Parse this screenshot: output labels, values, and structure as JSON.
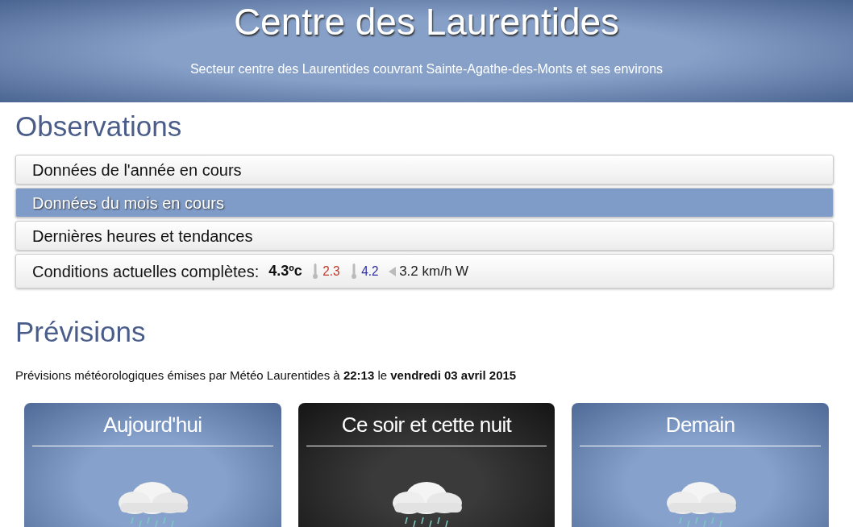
{
  "header": {
    "title": "Centre des Laurentides",
    "subtitle": "Secteur centre des Laurentides couvrant Sainte-Agathe-des-Monts et ses environs"
  },
  "observations": {
    "heading": "Observations",
    "items": [
      {
        "label": "Données de l'année en cours",
        "selected": false
      },
      {
        "label": "Données du mois en cours",
        "selected": true
      },
      {
        "label": "Dernières heures et tendances",
        "selected": false
      }
    ],
    "conditions": {
      "label": "Conditions actuelles complètes:",
      "temperature": "4.3ºc",
      "readings": [
        {
          "kind": "min",
          "value": "2.3",
          "color": "#c0392b"
        },
        {
          "kind": "max",
          "value": "4.2",
          "color": "#2e2ea8"
        },
        {
          "kind": "wind",
          "value": "3.2 km/h W"
        }
      ]
    }
  },
  "forecast": {
    "heading": "Prévisions",
    "intro": "Prévisions météorologiques émises par Météo Laurentides à **22:13** le **vendredi 03 avril 2015**",
    "cards": [
      {
        "title": "Aujourd'hui",
        "kind": "day"
      },
      {
        "title": "Ce soir et cette nuit",
        "kind": "night"
      },
      {
        "title": "Demain",
        "kind": "day"
      }
    ]
  }
}
